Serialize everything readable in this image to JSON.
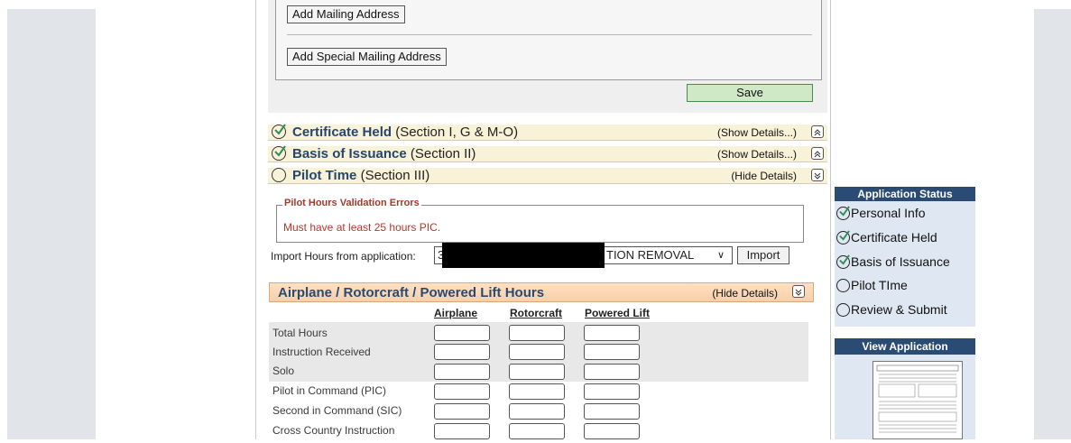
{
  "mailing": {
    "add_mailing": "Add Mailing Address",
    "add_special_mailing": "Add Special Mailing Address",
    "save": "Save"
  },
  "sections": [
    {
      "title": "Certificate Held",
      "sub": "(Section I, G & M-O)",
      "details": "(Show Details...)",
      "status": "complete"
    },
    {
      "title": "Basis of Issuance",
      "sub": "(Section II)",
      "details": "(Show Details...)",
      "status": "complete"
    },
    {
      "title": "Pilot Time",
      "sub": "(Section III)",
      "details": "(Hide Details)",
      "status": "incomplete"
    }
  ],
  "validation": {
    "legend": "Pilot Hours Validation Errors",
    "message": "Must have at least 25 hours PIC."
  },
  "import": {
    "label": "Import Hours from application:",
    "selected_prefix": "3",
    "selected_suffix": "TION REMOVAL",
    "button": "Import"
  },
  "hours": {
    "title": "Airplane / Rotorcraft / Powered Lift Hours",
    "details": "(Hide Details)",
    "columns": [
      "Airplane",
      "Rotorcraft",
      "Powered Lift"
    ],
    "rows": [
      "Total Hours",
      "Instruction Received",
      "Solo",
      "Pilot in Command (PIC)",
      "Second in Command (SIC)",
      "Cross Country Instruction"
    ]
  },
  "status_panel": {
    "title": "Application Status",
    "items": [
      {
        "label": "Personal Info",
        "done": true
      },
      {
        "label": "Certificate Held",
        "done": true
      },
      {
        "label": "Basis of Issuance",
        "done": true
      },
      {
        "label": "Pilot TIme",
        "done": false
      },
      {
        "label": "Review & Submit",
        "done": false
      }
    ]
  },
  "view_app": {
    "title": "View Application"
  },
  "colors": {
    "section_bar": "#f8f3d8",
    "header_navy": "#2a4b73",
    "error_red": "#b3392a",
    "save_green": "#cfe8c5"
  }
}
